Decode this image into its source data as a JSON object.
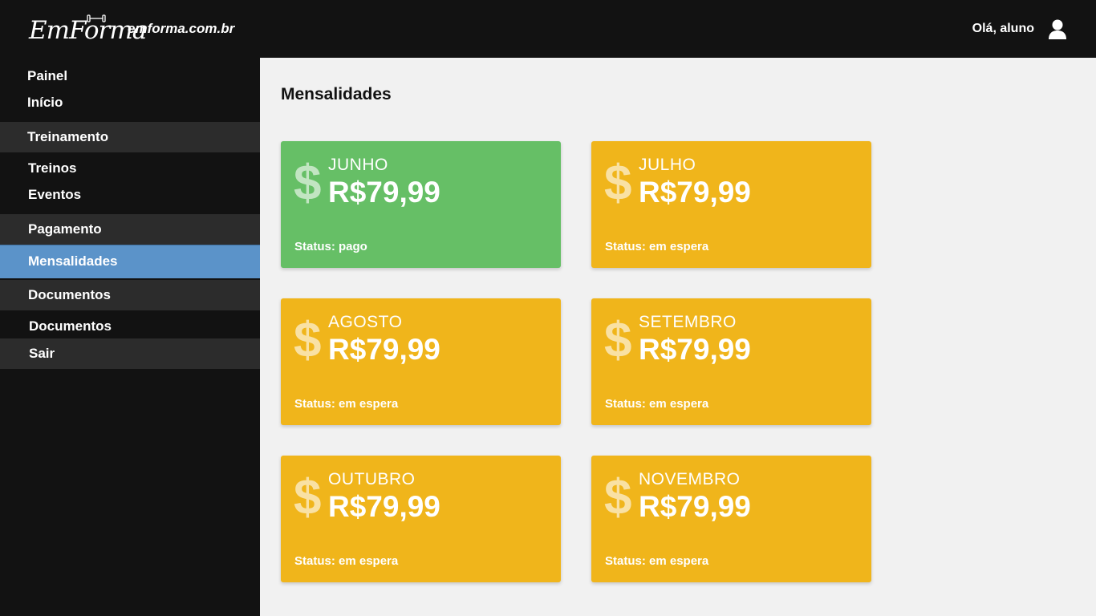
{
  "header": {
    "logo_text": "EmForma",
    "site_url": "emforma.com.br",
    "greeting": "Olá, aluno"
  },
  "sidebar": {
    "links_top": [
      "Painel",
      "Início"
    ],
    "sections": {
      "treinamento": {
        "title": "Treinamento",
        "links": [
          "Treinos",
          "Eventos"
        ]
      },
      "pagamento": {
        "title": "Pagamento",
        "active_link": "Mensalidades"
      },
      "documentos": {
        "title": "Documentos",
        "links": [
          "Documentos"
        ]
      },
      "sair": "Sair"
    }
  },
  "main": {
    "title": "Mensalidades",
    "currency_symbol": "$",
    "cards": [
      {
        "month": "JUNHO",
        "amount": "R$79,99",
        "status": "Status: pago",
        "state": "paid"
      },
      {
        "month": "JULHO",
        "amount": "R$79,99",
        "status": "Status: em espera",
        "state": "pending"
      },
      {
        "month": "AGOSTO",
        "amount": "R$79,99",
        "status": "Status: em espera",
        "state": "pending"
      },
      {
        "month": "SETEMBRO",
        "amount": "R$79,99",
        "status": "Status: em espera",
        "state": "pending"
      },
      {
        "month": "OUTUBRO",
        "amount": "R$79,99",
        "status": "Status: em espera",
        "state": "pending"
      },
      {
        "month": "NOVEMBRO",
        "amount": "R$79,99",
        "status": "Status: em espera",
        "state": "pending"
      }
    ]
  },
  "colors": {
    "topbar": "#121212",
    "sidebar": "#121212",
    "section_bg": "#2c2c2c",
    "active_bg": "#5b93c9",
    "paid": "#66bf66",
    "pending": "#f0b51b",
    "content_bg": "#f1f1f1"
  },
  "icons": {
    "logo_mark": "dumbbell-icon",
    "user": "user-icon",
    "card": "dollar-icon"
  }
}
